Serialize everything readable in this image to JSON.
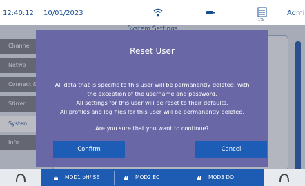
{
  "status": {
    "time": "12:40:12",
    "date": "10/01/2023",
    "storage_pct": "1%",
    "user": "Admin"
  },
  "settings": {
    "header": "System Settings",
    "sidebar": [
      "Channe",
      "Netwo",
      "Connect &",
      "Stirrer",
      "Systen",
      "Info"
    ],
    "active_index": 4
  },
  "dialog": {
    "title": "Reset User",
    "lines": [
      "All data that is specific to this user will be permanently deleted, with",
      "the exception of the username and password.",
      "All settings for this user will be reset to their defaults.",
      "All profiles and log files for this user will be permanently deleted."
    ],
    "question": "Are you sure that you want to continue?",
    "confirm": "Confirm",
    "cancel": "Cancel"
  },
  "bottom": {
    "modules": [
      "MOD1 pH/ISE",
      "MOD2 EC",
      "MOD3 DO"
    ]
  },
  "colors": {
    "accent": "#1d5cb2",
    "dialog": "#6a67a6",
    "text_blue": "#1a4f8f"
  }
}
